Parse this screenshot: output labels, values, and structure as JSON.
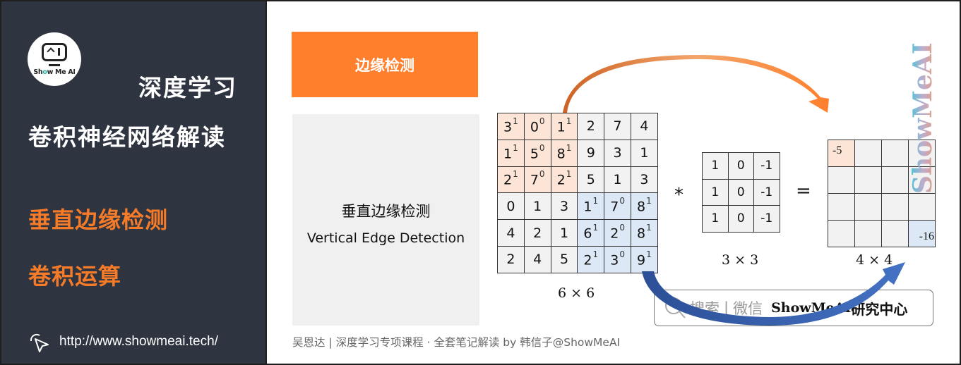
{
  "sidebar": {
    "logo_text_pre": "Sh",
    "logo_text_o": "o",
    "logo_text_post": "w Me AI",
    "title_line1": "深度学习",
    "title_line2": "卷积神经网络解读",
    "topics": [
      "垂直边缘检测",
      "卷积运算"
    ],
    "url": "http://www.showmeai.tech/"
  },
  "main": {
    "header_label": "边缘检测",
    "concept_zh": "垂直边缘检测",
    "concept_en": "Vertical Edge Detection",
    "input_matrix": {
      "label": "6 × 6",
      "rows": [
        [
          {
            "v": "3",
            "s": "1"
          },
          {
            "v": "0",
            "s": "0"
          },
          {
            "v": "1",
            "s": "1"
          },
          {
            "v": "2"
          },
          {
            "v": "7"
          },
          {
            "v": "4"
          }
        ],
        [
          {
            "v": "1",
            "s": "1"
          },
          {
            "v": "5",
            "s": "0"
          },
          {
            "v": "8",
            "s": "1"
          },
          {
            "v": "9"
          },
          {
            "v": "3"
          },
          {
            "v": "1"
          }
        ],
        [
          {
            "v": "2",
            "s": "1"
          },
          {
            "v": "7",
            "s": "0"
          },
          {
            "v": "2",
            "s": "1"
          },
          {
            "v": "5"
          },
          {
            "v": "1"
          },
          {
            "v": "3"
          }
        ],
        [
          {
            "v": "0"
          },
          {
            "v": "1"
          },
          {
            "v": "3"
          },
          {
            "v": "1",
            "s": "1"
          },
          {
            "v": "7",
            "s": "0"
          },
          {
            "v": "8",
            "s": "1"
          }
        ],
        [
          {
            "v": "4"
          },
          {
            "v": "2"
          },
          {
            "v": "1"
          },
          {
            "v": "6",
            "s": "1"
          },
          {
            "v": "2",
            "s": "0"
          },
          {
            "v": "8",
            "s": "1"
          }
        ],
        [
          {
            "v": "2"
          },
          {
            "v": "4"
          },
          {
            "v": "5"
          },
          {
            "v": "2",
            "s": "1"
          },
          {
            "v": "3",
            "s": "0"
          },
          {
            "v": "9",
            "s": "1"
          }
        ]
      ]
    },
    "operator_conv": "*",
    "kernel": {
      "label": "3 × 3",
      "rows": [
        [
          "1",
          "0",
          "-1"
        ],
        [
          "1",
          "0",
          "-1"
        ],
        [
          "1",
          "0",
          "-1"
        ]
      ]
    },
    "operator_eq": "=",
    "output_matrix": {
      "label": "4 × 4",
      "top_left": "-5",
      "bottom_right": "-16"
    },
    "colors": {
      "accent_orange": "#ff7f2c",
      "highlight_orange": "#fce4d6",
      "highlight_blue": "#dce8f5",
      "arrow_blue": "#4472c4"
    }
  },
  "watermark": "ShowMeAI",
  "search_badge": {
    "label": "搜索",
    "separator": "|",
    "channel": "微信",
    "brand_en": "ShowMeAI",
    "brand_zh": "研究中心"
  },
  "footer": "吴恩达 | 深度学习专项课程 · 全套笔记解读  by 韩信子@ShowMeAI"
}
